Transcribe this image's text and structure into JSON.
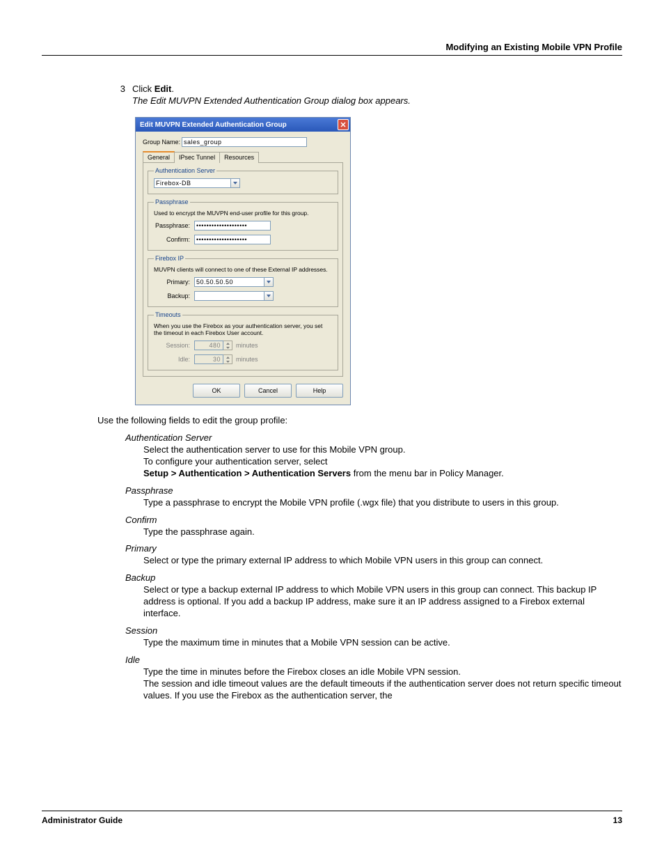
{
  "header": {
    "section_title": "Modifying an Existing Mobile VPN Profile"
  },
  "step": {
    "number": "3",
    "prefix": "Click ",
    "bold": "Edit",
    "suffix": ".",
    "caption": "The Edit MUVPN Extended Authentication Group dialog box appears."
  },
  "dialog": {
    "title": "Edit MUVPN Extended Authentication Group",
    "group_name_label": "Group Name:",
    "group_name_value": "sales_group",
    "tabs": {
      "general": "General",
      "ipsec": "IPsec Tunnel",
      "resources": "Resources"
    },
    "auth": {
      "legend": "Authentication Server",
      "value": "Firebox-DB"
    },
    "pass": {
      "legend": "Passphrase",
      "hint": "Used to encrypt the MUVPN end-user profile for this group.",
      "label_pass": "Passphrase:",
      "label_confirm": "Confirm:",
      "mask": "••••••••••••••••••••"
    },
    "fbip": {
      "legend": "Firebox IP",
      "hint": "MUVPN clients will connect to one of these External IP addresses.",
      "label_primary": "Primary:",
      "label_backup": "Backup:",
      "primary_value": "50.50.50.50",
      "backup_value": ""
    },
    "timeouts": {
      "legend": "Timeouts",
      "hint": "When you use the Firebox as your authentication server, you set the timeout in each Firebox User account.",
      "label_session": "Session:",
      "label_idle": "Idle:",
      "session_value": "480",
      "idle_value": "30",
      "unit": "minutes"
    },
    "buttons": {
      "ok": "OK",
      "cancel": "Cancel",
      "help": "Help"
    }
  },
  "intro": "Use the following fields to edit the group profile:",
  "defs": {
    "auth": {
      "term": "Authentication Server",
      "l1": "Select the authentication server to use for this Mobile VPN group.",
      "l2": "To configure your authentication server, select",
      "l3b": "Setup > Authentication > Authentication Servers",
      "l3": " from the menu bar in Policy Manager."
    },
    "pass": {
      "term": "Passphrase",
      "body": "Type a passphrase to encrypt the Mobile VPN profile (.wgx file) that you distribute to users in this group."
    },
    "confirm": {
      "term": "Confirm",
      "body": "Type the passphrase again."
    },
    "primary": {
      "term": "Primary",
      "body": "Select or type the primary external IP address to which Mobile VPN users in this group can connect."
    },
    "backup": {
      "term": "Backup",
      "body": "Select or type a backup external IP address to which Mobile VPN users in this group can connect. This backup IP address is optional. If you add a backup IP address, make sure it an IP address assigned to a Firebox external interface."
    },
    "session": {
      "term": "Session",
      "body": "Type the maximum time in minutes that a Mobile VPN session can be active."
    },
    "idle": {
      "term": "Idle",
      "l1": "Type the time in minutes before the Firebox closes an idle Mobile VPN session.",
      "l2": "The session and idle timeout values are the default timeouts if the authentication server does not return specific timeout values. If you use the Firebox as the authentication server, the"
    }
  },
  "footer": {
    "guide": "Administrator Guide",
    "page": "13"
  }
}
